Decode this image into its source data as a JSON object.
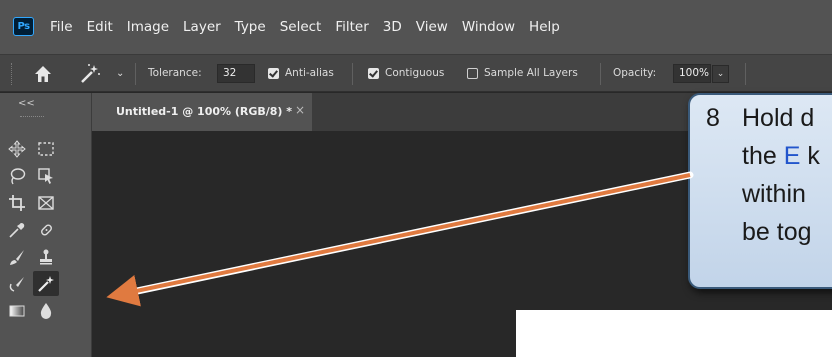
{
  "app": {
    "logo": "Ps"
  },
  "menu": [
    "File",
    "Edit",
    "Image",
    "Layer",
    "Type",
    "Select",
    "Filter",
    "3D",
    "View",
    "Window",
    "Help"
  ],
  "options": {
    "tolerance_label": "Tolerance:",
    "tolerance_value": "32",
    "anti_alias_label": "Anti-alias",
    "anti_alias_checked": true,
    "contiguous_label": "Contiguous",
    "contiguous_checked": true,
    "sample_all_label": "Sample All Layers",
    "sample_all_checked": false,
    "opacity_label": "Opacity:",
    "opacity_value": "100%"
  },
  "tab": {
    "title": "Untitled-1 @ 100% (RGB/8) *",
    "close": "×"
  },
  "toolbox": {
    "collapse": "<<",
    "tools": [
      [
        "move-tool-icon",
        "marquee-tool-icon"
      ],
      [
        "lasso-tool-icon",
        "object-selection-tool-icon"
      ],
      [
        "crop-tool-icon",
        "frame-tool-icon"
      ],
      [
        "eyedropper-tool-icon",
        "healing-brush-tool-icon"
      ],
      [
        "brush-tool-icon",
        "clone-stamp-tool-icon"
      ],
      [
        "history-brush-tool-icon",
        "eraser-tool-icon"
      ],
      [
        "gradient-tool-icon",
        "blur-tool-icon"
      ]
    ],
    "active_tool": "eraser-tool-icon"
  },
  "callout": {
    "number": "8",
    "line1": "Hold d",
    "line2_prefix": "the ",
    "line2_key": "E",
    "line2_suffix": " k",
    "line3": "within",
    "line4": "be tog"
  },
  "colors": {
    "arrow": "#e07a40",
    "callout_border": "#3a5a7a",
    "ps_blue": "#31a8ff",
    "key_blue": "#2255cc"
  }
}
